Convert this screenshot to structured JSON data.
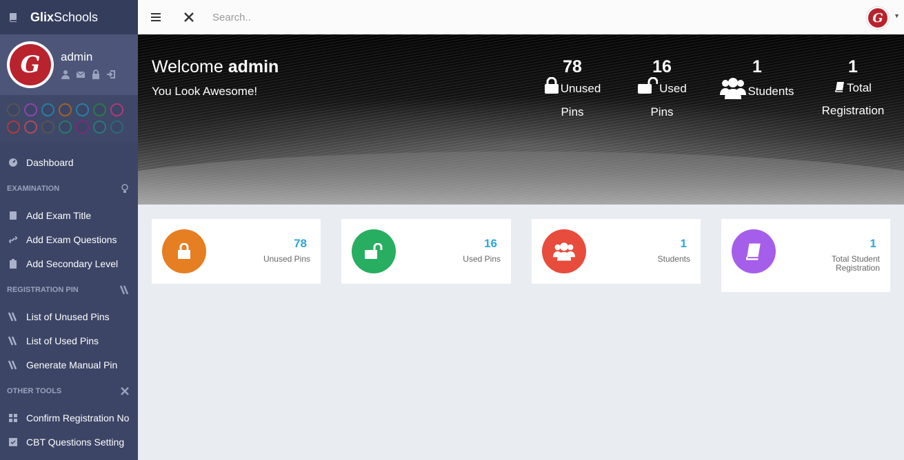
{
  "app": {
    "brand_bold": "Glix",
    "brand_rest": "Schools",
    "avatar_letter": "G"
  },
  "profile": {
    "name": "admin",
    "swatch_colors": [
      "#555555",
      "#8e44ad",
      "#2a7fa0",
      "#a0622a",
      "#2a7fa0",
      "#2a7a4a",
      "#b03a7a",
      "#b03a3a",
      "#b04a5a",
      "#555555",
      "#2a7a6a",
      "#7a2a7a",
      "#2a7a7a",
      "#2a6a7a"
    ]
  },
  "sidebar": {
    "dashboard": "Dashboard",
    "sections": {
      "examination": "EXAMINATION",
      "registration_pin": "REGISTRATION PIN",
      "other_tools": "OTHER TOOLS"
    },
    "items": {
      "add_exam_title": "Add Exam Title",
      "add_exam_questions": "Add Exam Questions",
      "add_secondary_level": "Add Secondary Level",
      "list_unused_pins": "List of Unused Pins",
      "list_used_pins": "List of Used Pins",
      "generate_manual_pin": "Generate Manual Pin",
      "confirm_registration_no": "Confirm Registration No",
      "cbt_questions_setting": "CBT Questions Setting"
    }
  },
  "topbar": {
    "search_placeholder": "Search.."
  },
  "hero": {
    "welcome": "Welcome",
    "user": "admin",
    "subtitle": "You Look Awesome!",
    "stats": {
      "unused": {
        "value": "78",
        "label1": "Unused",
        "label2": "Pins"
      },
      "used": {
        "value": "16",
        "label1": "Used",
        "label2": "Pins"
      },
      "students": {
        "value": "1",
        "label1": "Students"
      },
      "total": {
        "value": "1",
        "label1": "Total",
        "label2": "Registration"
      }
    }
  },
  "cards": {
    "unused": {
      "value": "78",
      "label": "Unused Pins",
      "color": "#e67e22"
    },
    "used": {
      "value": "16",
      "label": "Used Pins",
      "color": "#27ae60"
    },
    "students": {
      "value": "1",
      "label": "Students",
      "color": "#e74c3c"
    },
    "total": {
      "value": "1",
      "label1": "Total Student",
      "label2": "Registration",
      "color": "#a55eea"
    }
  }
}
